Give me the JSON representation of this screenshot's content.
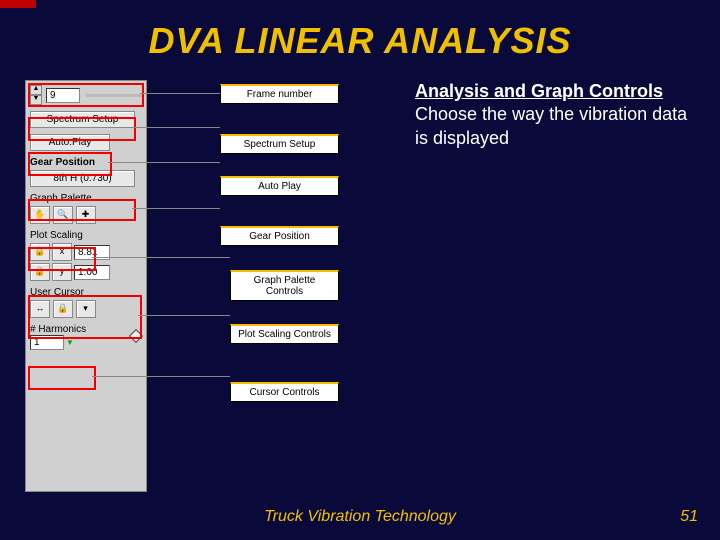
{
  "title": "DVA LINEAR ANALYSIS",
  "panel": {
    "frame_value": "9",
    "spectrum_btn": "Spectrum Setup",
    "autoplay_btn": "Auto.Play",
    "gear_label": "Gear Position",
    "gear_value": "8th H (0.730)",
    "graph_palette_label": "Graph Palette",
    "plot_scaling_label": "Plot Scaling",
    "plot_val1": "8.81",
    "plot_val2": "1.00",
    "user_cursor_label": "User Cursor",
    "harmonics_label": "# Harmonics",
    "harmonics_value": "1"
  },
  "labels": {
    "frame": "Frame number",
    "spectrum": "Spectrum Setup",
    "autoplay": "Auto Play",
    "gear": "Gear Position",
    "graph": "Graph Palette Controls",
    "plot": "Plot Scaling Controls",
    "cursor": "Cursor Controls"
  },
  "body": {
    "heading": "Analysis and Graph Controls",
    "text": "Choose the way the vibration data is displayed"
  },
  "footer": "Truck Vibration Technology",
  "page": "51"
}
